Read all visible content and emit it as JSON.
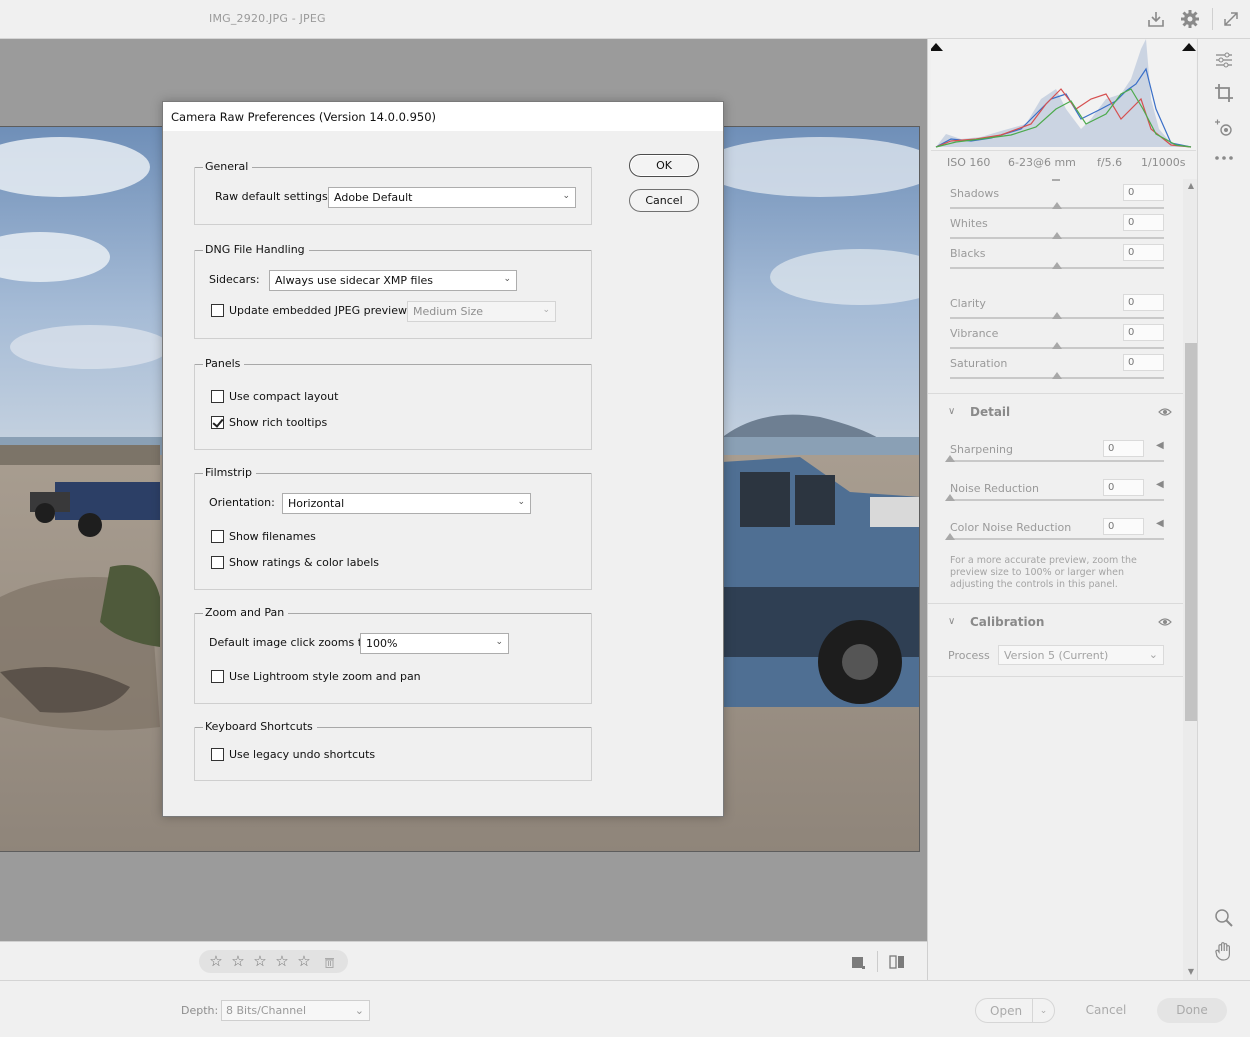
{
  "window": {
    "title": "IMG_2920.JPG  -  JPEG"
  },
  "bottom": {
    "depth_label": "Depth:",
    "depth_value": "8 Bits/Channel",
    "open": "Open",
    "cancel": "Cancel",
    "done": "Done",
    "rating_stars": 5
  },
  "exif": {
    "iso": "ISO 160",
    "lens": "6-23@6 mm",
    "aperture": "f/5.6",
    "shutter": "1/1000s"
  },
  "basic_sliders": [
    {
      "label": "Shadows",
      "value": "0"
    },
    {
      "label": "Whites",
      "value": "0"
    },
    {
      "label": "Blacks",
      "value": "0"
    },
    {
      "label": "Clarity",
      "value": "0"
    },
    {
      "label": "Vibrance",
      "value": "0"
    },
    {
      "label": "Saturation",
      "value": "0"
    }
  ],
  "detail": {
    "title": "Detail",
    "sliders": [
      {
        "label": "Sharpening",
        "value": "0"
      },
      {
        "label": "Noise Reduction",
        "value": "0"
      },
      {
        "label": "Color Noise Reduction",
        "value": "0"
      }
    ],
    "note": "For a more accurate preview, zoom the preview size to 100% or larger when adjusting the controls in this panel."
  },
  "calibration": {
    "title": "Calibration",
    "process_label": "Process",
    "process_value": "Version 5 (Current)"
  },
  "dialog": {
    "title": "Camera Raw Preferences  (Version 14.0.0.950)",
    "ok": "OK",
    "cancel": "Cancel",
    "general": {
      "title": "General",
      "raw_default_label": "Raw default settings:",
      "raw_default_value": "Adobe Default"
    },
    "dng": {
      "title": "DNG File Handling",
      "sidecars_label": "Sidecars:",
      "sidecars_value": "Always use sidecar XMP files",
      "update_jpeg_label": "Update embedded JPEG previews:",
      "update_jpeg_value": "Medium Size",
      "update_jpeg_checked": false
    },
    "panels": {
      "title": "Panels",
      "compact_label": "Use compact layout",
      "compact_checked": false,
      "tooltips_label": "Show rich tooltips",
      "tooltips_checked": true
    },
    "filmstrip": {
      "title": "Filmstrip",
      "orientation_label": "Orientation:",
      "orientation_value": "Horizontal",
      "filenames_label": "Show filenames",
      "ratings_label": "Show ratings & color labels"
    },
    "zoom": {
      "title": "Zoom and Pan",
      "default_zoom_label": "Default image click zooms to:",
      "default_zoom_value": "100%",
      "lightroom_label": "Use Lightroom style zoom and pan"
    },
    "keyboard": {
      "title": "Keyboard Shortcuts",
      "legacy_label": "Use legacy undo shortcuts"
    }
  },
  "colors": {
    "panel_bg": "#f0f0f0",
    "canvas_bg": "#9b9b9b",
    "dialog_bg": "#f0f0f0"
  }
}
